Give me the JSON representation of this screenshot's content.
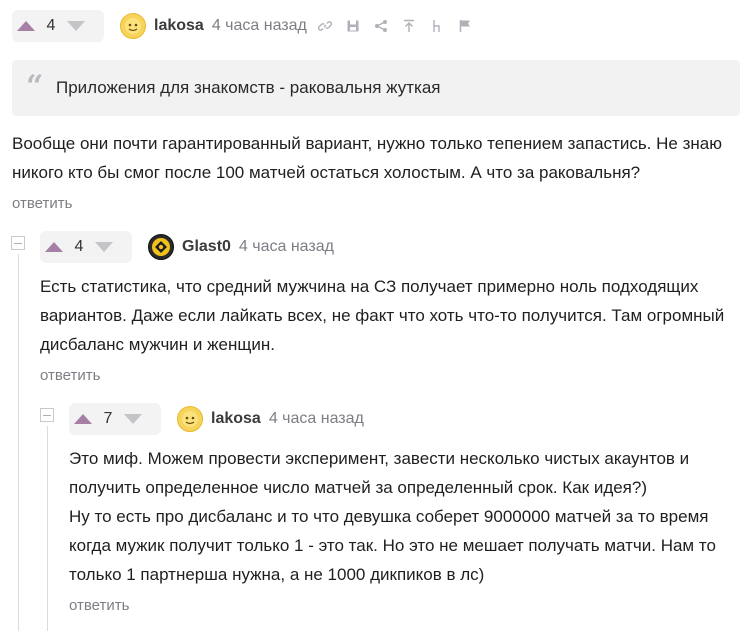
{
  "comment1": {
    "votes": "4",
    "author": "lakosa",
    "time": "4 часа назад",
    "quote": "Приложения для знакомств - раковальня жуткая",
    "text_line1": "Вообще они почти гарантированный вариант, нужно только тепением запастись. Не знаю",
    "text_line2": "никого кто бы смог после 100 матчей остаться холостым. А что за раковальня?",
    "reply": "ответить"
  },
  "comment2": {
    "votes": "4",
    "author": "Glast0",
    "time": "4 часа назад",
    "text_line1": "Есть статистика, что средний мужчина на СЗ получает примерно ноль подходящих",
    "text_line2": "вариантов. Даже если лайкать всех, не факт что хоть что-то получится. Там огромный",
    "text_line3": "дисбаланс мужчин и женщин.",
    "reply": "ответить"
  },
  "comment3": {
    "votes": "7",
    "author": "lakosa",
    "time": "4 часа назад",
    "text_line1": "Это миф. Можем провести эксперимент, завести несколько чистых акаунтов и",
    "text_line2": "получить определенное число матчей за определенный срок. Как идея?)",
    "text_line3": "Ну то есть про дисбаланс и то что девушка соберет 9000000 матчей за то время",
    "text_line4": "когда мужик получит только 1 - это так. Но это не мешает получать матчи. Нам то",
    "text_line5": "только 1 партнерша нужна, а не 1000 дикпиков в лс)",
    "reply": "ответить"
  },
  "icons": [
    "arrow-up-icon",
    "arrow-down-icon",
    "link-icon",
    "save-icon",
    "share-icon",
    "pin-top-icon",
    "branch-icon",
    "flag-icon",
    "quote-icon",
    "collapse-icon"
  ],
  "colors": {
    "upvote": "#a67fa7",
    "downvote": "#c3c3c8",
    "muted": "#7d7d85"
  }
}
